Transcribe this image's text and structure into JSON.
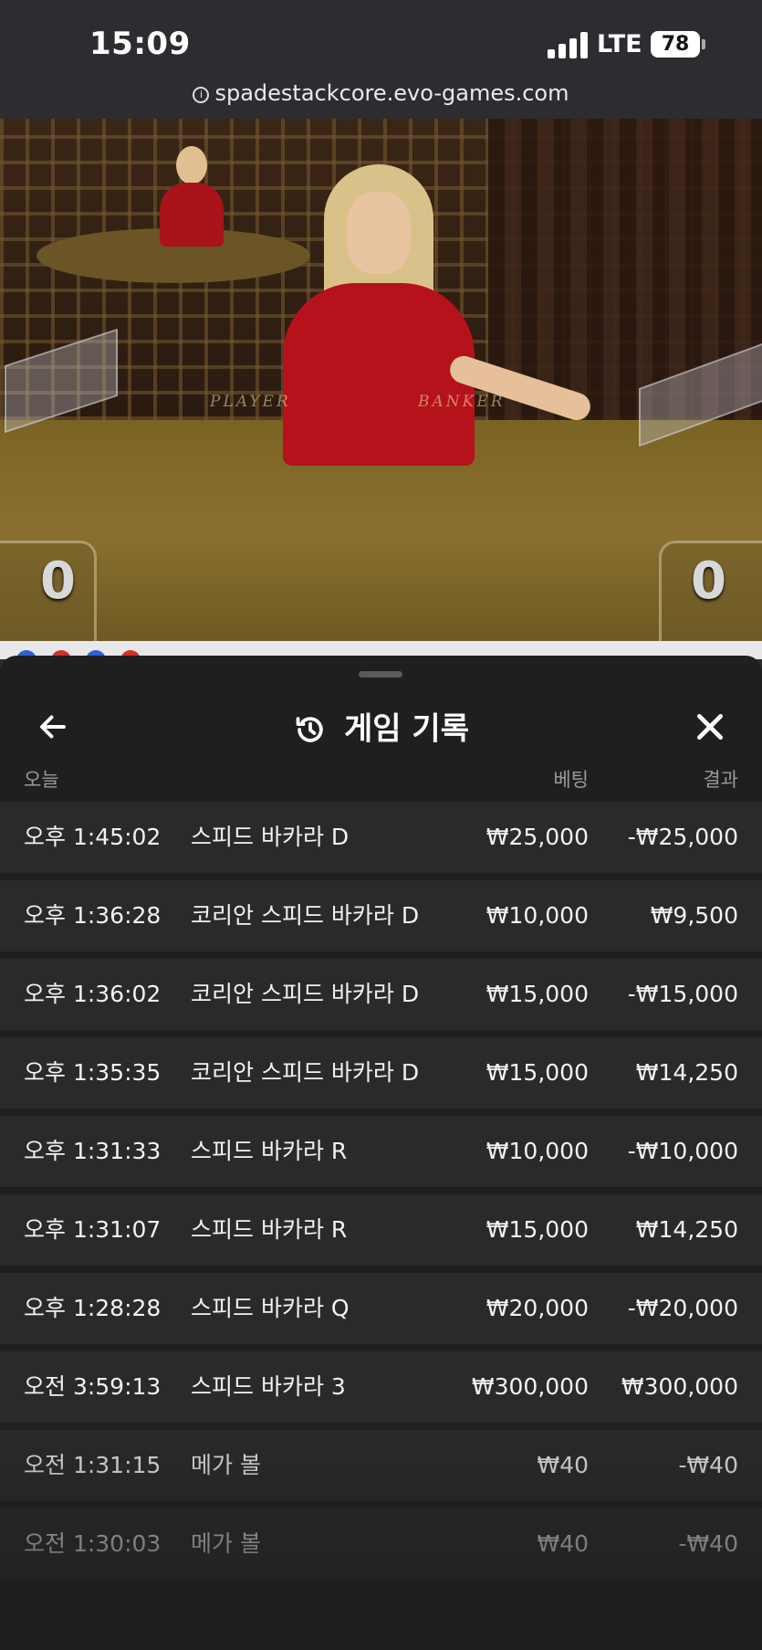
{
  "status_bar": {
    "time": "15:09",
    "network": "LTE",
    "battery": "78"
  },
  "browser": {
    "url": "spadestackcore.evo-games.com"
  },
  "video": {
    "felt_player_label": "PLAYER",
    "felt_banker_label": "BANKER",
    "player_score": "0",
    "banker_score": "0"
  },
  "sheet": {
    "title": "게임 기록",
    "header_today": "오늘",
    "header_bet": "베팅",
    "header_result": "결과",
    "rows": [
      {
        "time": "오후 1:45:02",
        "game": "스피드 바카라 D",
        "bet": "₩25,000",
        "result": "-₩25,000"
      },
      {
        "time": "오후 1:36:28",
        "game": "코리안 스피드 바카라 D",
        "bet": "₩10,000",
        "result": "₩9,500"
      },
      {
        "time": "오후 1:36:02",
        "game": "코리안 스피드 바카라 D",
        "bet": "₩15,000",
        "result": "-₩15,000"
      },
      {
        "time": "오후 1:35:35",
        "game": "코리안 스피드 바카라 D",
        "bet": "₩15,000",
        "result": "₩14,250"
      },
      {
        "time": "오후 1:31:33",
        "game": "스피드 바카라 R",
        "bet": "₩10,000",
        "result": "-₩10,000"
      },
      {
        "time": "오후 1:31:07",
        "game": "스피드 바카라 R",
        "bet": "₩15,000",
        "result": "₩14,250"
      },
      {
        "time": "오후 1:28:28",
        "game": "스피드 바카라 Q",
        "bet": "₩20,000",
        "result": "-₩20,000"
      },
      {
        "time": "오전 3:59:13",
        "game": "스피드 바카라 3",
        "bet": "₩300,000",
        "result": "₩300,000"
      },
      {
        "time": "오전 1:31:15",
        "game": "메가 볼",
        "bet": "₩40",
        "result": "-₩40"
      },
      {
        "time": "오전 1:30:03",
        "game": "메가 볼",
        "bet": "₩40",
        "result": "-₩40"
      }
    ]
  },
  "icons": {
    "back": "arrow-left-icon",
    "history": "history-icon",
    "close": "close-icon",
    "signal": "signal-icon",
    "info": "info-icon"
  }
}
